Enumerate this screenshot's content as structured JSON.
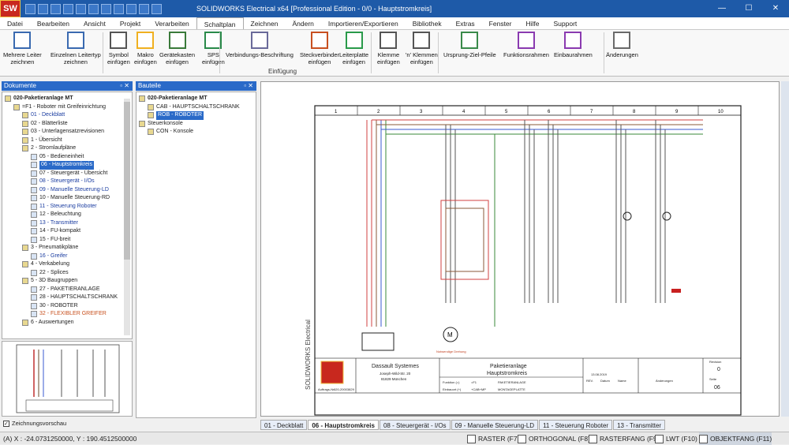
{
  "window": {
    "title": "SOLIDWORKS Electrical x64 [Professional Edition - 0/0 - Hauptstromkreis]",
    "logo": "SW",
    "minimize": "—",
    "maximize": "☐",
    "close": "✕"
  },
  "menu": [
    "Datei",
    "Bearbeiten",
    "Ansicht",
    "Projekt",
    "Verarbeiten",
    "Schaltplan",
    "Zeichnen",
    "Ändern",
    "Importieren/Exportieren",
    "Bibliothek",
    "Extras",
    "Fenster",
    "Hilfe",
    "Support"
  ],
  "menu_active": "Schaltplan",
  "ribbon": {
    "buttons": [
      {
        "l1": "Mehrere Leiter",
        "l2": "zeichnen"
      },
      {
        "l1": "Einzelnen Leitertyp",
        "l2": "zeichnen"
      },
      {
        "l1": "Symbol",
        "l2": "einfügen"
      },
      {
        "l1": "Makro",
        "l2": "einfügen"
      },
      {
        "l1": "Gerätekasten",
        "l2": "einfügen"
      },
      {
        "l1": "SPS",
        "l2": "einfügen"
      },
      {
        "l1": "Verbindungs-Beschriftung",
        "l2": ""
      },
      {
        "l1": "Steckverbinder",
        "l2": "einfügen"
      },
      {
        "l1": "Leiterplatte",
        "l2": "einfügen"
      },
      {
        "l1": "Klemme",
        "l2": "einfügen"
      },
      {
        "l1": "'n' Klemmen",
        "l2": "einfügen"
      },
      {
        "l1": "Ursprung-Ziel-Pfeile",
        "l2": ""
      },
      {
        "l1": "Funktionsrahmen",
        "l2": ""
      },
      {
        "l1": "Einbaurahmen",
        "l2": ""
      },
      {
        "l1": "Änderungen",
        "l2": ""
      }
    ],
    "group_label": "Einfügung"
  },
  "documents": {
    "header": "Dokumente",
    "items": [
      {
        "t": "020-Paketieranlage MT",
        "lvl": 0,
        "c": "bold"
      },
      {
        "t": "=F1 - Roboter mit Greifeinrichtung",
        "lvl": 1,
        "c": ""
      },
      {
        "t": "01 - Deckblatt",
        "lvl": 2,
        "c": "blue"
      },
      {
        "t": "02 - Blätterliste",
        "lvl": 2,
        "c": ""
      },
      {
        "t": "03 - Unterlagensatzrevisionen",
        "lvl": 2,
        "c": ""
      },
      {
        "t": "1 - Übersicht",
        "lvl": 2,
        "c": ""
      },
      {
        "t": "2 - Stromlaufpläne",
        "lvl": 2,
        "c": ""
      },
      {
        "t": "05 - Bedieneinheit",
        "lvl": 3,
        "c": ""
      },
      {
        "t": "06 - Hauptstromkreis",
        "lvl": 3,
        "c": "sel"
      },
      {
        "t": "07 - Steuergerät - Übersicht",
        "lvl": 3,
        "c": ""
      },
      {
        "t": "08 - Steuergerät - I/Os",
        "lvl": 3,
        "c": "blue"
      },
      {
        "t": "09 - Manuelle Steuerung-LD",
        "lvl": 3,
        "c": "blue"
      },
      {
        "t": "10 - Manuelle Steuerung-RD",
        "lvl": 3,
        "c": ""
      },
      {
        "t": "11 - Steuerung Roboter",
        "lvl": 3,
        "c": "blue"
      },
      {
        "t": "12 - Beleuchtung",
        "lvl": 3,
        "c": ""
      },
      {
        "t": "13 - Transmitter",
        "lvl": 3,
        "c": "blue"
      },
      {
        "t": "14 - FU-kompakt",
        "lvl": 3,
        "c": ""
      },
      {
        "t": "15 - FU-breit",
        "lvl": 3,
        "c": ""
      },
      {
        "t": "3 - Pneumatikpläne",
        "lvl": 2,
        "c": ""
      },
      {
        "t": "16 - Greifer",
        "lvl": 3,
        "c": "blue"
      },
      {
        "t": "4 - Verkabelung",
        "lvl": 2,
        "c": ""
      },
      {
        "t": "22 - Splices",
        "lvl": 3,
        "c": ""
      },
      {
        "t": "5 - 3D Baugruppen",
        "lvl": 2,
        "c": ""
      },
      {
        "t": "27 - PAKETIERANLAGE",
        "lvl": 3,
        "c": ""
      },
      {
        "t": "28 - HAUPTSCHALTSCHRANK",
        "lvl": 3,
        "c": ""
      },
      {
        "t": "30 - ROBOTER",
        "lvl": 3,
        "c": ""
      },
      {
        "t": "32 - FLEXIBLER GREIFER",
        "lvl": 3,
        "c": "orange"
      },
      {
        "t": "6 - Auswertungen",
        "lvl": 2,
        "c": ""
      }
    ]
  },
  "components": {
    "header": "Bauteile",
    "items": [
      {
        "t": "020-Paketieranlage MT",
        "lvl": 0,
        "c": "bold"
      },
      {
        "t": "CAB - HAUPTSCHALTSCHRANK",
        "lvl": 1,
        "c": ""
      },
      {
        "t": "ROB - ROBOTER",
        "lvl": 1,
        "c": "sel"
      },
      {
        "t": "Steuerkonsole",
        "lvl": 0,
        "c": ""
      },
      {
        "t": "CON - Konsole",
        "lvl": 1,
        "c": ""
      }
    ]
  },
  "preview_label": "Zeichnungsvorschau",
  "drawing": {
    "columns": [
      "1",
      "2",
      "3",
      "4",
      "5",
      "6",
      "7",
      "8",
      "9",
      "10"
    ],
    "vertical_label": "SOLIDWORKS Electrical",
    "company": "Dassault Systemes",
    "address1": "Joseph-Wild-Str. 20",
    "address2": "81829 München",
    "project_title1": "Paketieranlage",
    "project_title2": "Hauptstromkreis",
    "function_label": "Funktion (=)",
    "function_val": "=F1",
    "location_label": "Einbauort (+)",
    "location_val": "+CAB+MP",
    "pak_label": "PAKETIERANLAGE",
    "mount_label": "MONTAGEPLATTE",
    "order_label": "Auftrags-Nr.:",
    "order_val": "020-20003829",
    "date_val": "13.08.2019",
    "rev_label": "REV.",
    "date_label": "Datum",
    "name_label": "Name",
    "changes_label": "Änderungen",
    "revision_label": "Revision",
    "revision_val": "0",
    "page_label": "Seite",
    "page_val": "06",
    "motor_label": "M",
    "note_label": "Notwendige Drehung"
  },
  "tabs": [
    {
      "t": "01 - Deckblatt",
      "active": false
    },
    {
      "t": "06 - Hauptstromkreis",
      "active": true
    },
    {
      "t": "08 - Steuergerät - I/Os",
      "active": false
    },
    {
      "t": "09 - Manuelle Steuerung-LD",
      "active": false
    },
    {
      "t": "11 - Steuerung Roboter",
      "active": false
    },
    {
      "t": "13 - Transmitter",
      "active": false
    }
  ],
  "status": {
    "coords": "(A) X : -24.0731250000, Y : 190.4512500000",
    "raster": "RASTER (F7)",
    "ortho": "ORTHOGONAL (F8)",
    "rasterfang": "RASTERFANG (F9)",
    "lwt": "LWT (F10)",
    "objektfang": "OBJEKTFANG (F11)"
  },
  "colors": {
    "accent": "#2a6ac8",
    "title_bar": "#1e5aa8",
    "wire_red": "#d04040",
    "wire_brown": "#8a5a3a",
    "wire_green": "#3a8a3a",
    "wire_blue": "#3a5ad0"
  }
}
